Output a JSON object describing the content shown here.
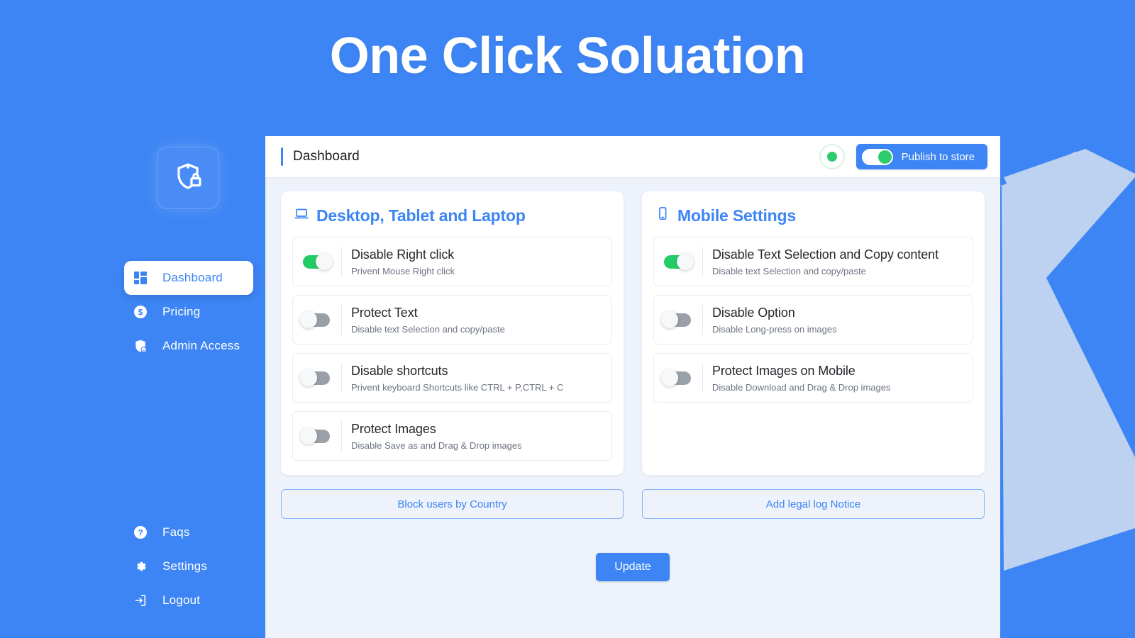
{
  "app": {
    "title": "One Click Soluation",
    "brand_color": "#3d85f4",
    "logo_icon": "shield-lock-icon"
  },
  "sidebar": {
    "top_items": [
      {
        "label": "Dashboard",
        "icon": "grid-dashboard-icon",
        "active": true
      },
      {
        "label": "Pricing",
        "icon": "dollar-circle-icon",
        "active": false
      },
      {
        "label": "Admin Access",
        "icon": "shield-user-icon",
        "active": false
      }
    ],
    "bottom_items": [
      {
        "label": "Faqs",
        "icon": "question-circle-icon"
      },
      {
        "label": "Settings",
        "icon": "gear-icon"
      },
      {
        "label": "Logout",
        "icon": "logout-arrow-icon"
      }
    ]
  },
  "topbar": {
    "title": "Dashboard",
    "status": {
      "icon": "status-dot-icon",
      "color": "#2ecc6b",
      "state": "on"
    },
    "publish": {
      "label": "Publish to store",
      "state": "on",
      "knob_color": "#2ecc6b"
    }
  },
  "left_card": {
    "heading": "Desktop, Tablet and Laptop",
    "heading_icon": "laptop-icon",
    "rows": [
      {
        "title": "Disable Right click",
        "subtitle": "Privent Mouse Right click",
        "state": "on"
      },
      {
        "title": "Protect Text",
        "subtitle": "Disable text Selection and copy/paste",
        "state": "off"
      },
      {
        "title": "Disable shortcuts",
        "subtitle": "Privent keyboard Shortcuts like CTRL + P,CTRL + C",
        "state": "off"
      },
      {
        "title": "Protect Images",
        "subtitle": "Disable Save as and Drag & Drop images",
        "state": "off"
      }
    ],
    "action_label": "Block users by Country"
  },
  "right_card": {
    "heading": "Mobile Settings",
    "heading_icon": "mobile-phone-icon",
    "rows": [
      {
        "title": "Disable Text Selection and Copy content",
        "subtitle": "Disable text Selection and copy/paste",
        "state": "on"
      },
      {
        "title": "Disable Option",
        "subtitle": "Disable Long-press on images",
        "state": "off"
      },
      {
        "title": "Protect Images on Mobile",
        "subtitle": "Disable Download and Drag & Drop images",
        "state": "off"
      }
    ],
    "action_label": "Add legal log Notice"
  },
  "footer": {
    "update_label": "Update"
  }
}
